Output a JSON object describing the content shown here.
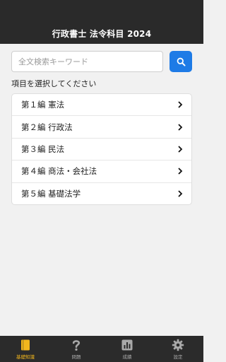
{
  "header": {
    "title": "行政書士 法令科目 2024"
  },
  "search": {
    "placeholder": "全文検索キーワード",
    "value": ""
  },
  "section_label": "項目を選択してください",
  "chapters": [
    {
      "label": "第１編 憲法"
    },
    {
      "label": "第２編 行政法"
    },
    {
      "label": "第３編 民法"
    },
    {
      "label": "第４編 商法・会社法"
    },
    {
      "label": "第５編 基礎法学"
    }
  ],
  "tabs": [
    {
      "label": "基礎知識",
      "icon": "book-icon",
      "active": true
    },
    {
      "label": "問題",
      "icon": "question-icon",
      "active": false
    },
    {
      "label": "成績",
      "icon": "chart-icon",
      "active": false
    },
    {
      "label": "設定",
      "icon": "gear-icon",
      "active": false
    }
  ],
  "colors": {
    "header_bg": "#2a2a2a",
    "accent_blue": "#1e7be6",
    "tab_active": "#f2b61d",
    "tab_inactive": "#a8a8a8"
  }
}
